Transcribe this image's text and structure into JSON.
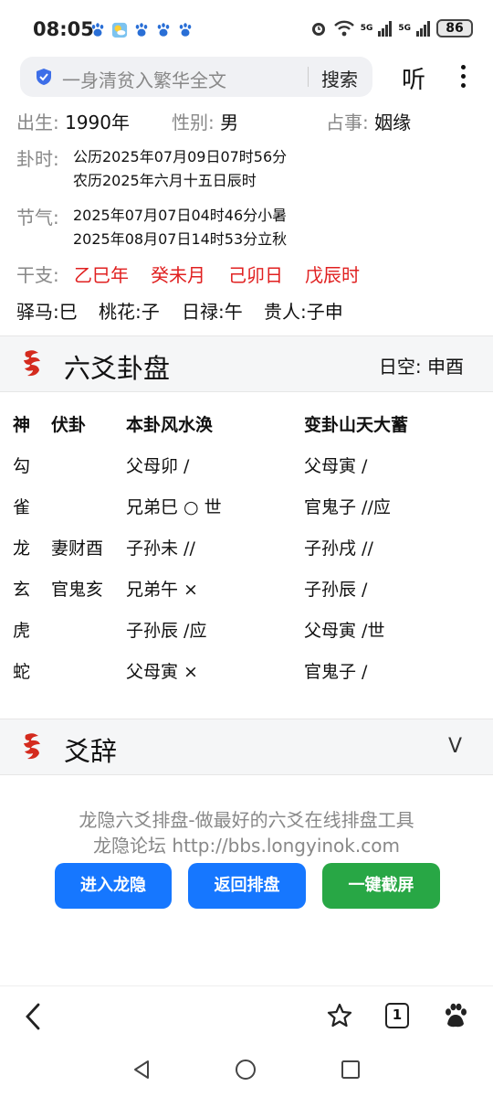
{
  "status_bar": {
    "time": "08:05",
    "battery": "86",
    "net1": "5G",
    "net2": "5G"
  },
  "address_bar": {
    "text": "一身清贫入繁华全文",
    "search_label": "搜索",
    "listen_label": "听"
  },
  "info": {
    "birth_label": "出生:",
    "birth_value": "1990年",
    "gender_label": "性别:",
    "gender_value": "男",
    "matter_label": "占事:",
    "matter_value": "姻缘",
    "time_label": "卦时:",
    "time_line1": "公历2025年07月09日07时56分",
    "time_line2": "农历2025年六月十五日辰时",
    "solar_label": "节气:",
    "solar_line1": "2025年07月07日04时46分小暑",
    "solar_line2": "2025年08月07日14时53分立秋",
    "ganzhi_label": "干支:",
    "ganzhi": [
      "乙巳年",
      "癸未月",
      "己卯日",
      "戊辰时"
    ],
    "extras": [
      "驿马:巳",
      "桃花:子",
      "日禄:午",
      "贵人:子申"
    ]
  },
  "section_gua": {
    "title": "六爻卦盘",
    "kong_label": "日空:",
    "kong_value": "申酉"
  },
  "gua_table": {
    "headers": [
      "神",
      "伏卦",
      "本卦风水涣",
      "变卦山天大蓄"
    ],
    "rows": [
      [
        "勾",
        "",
        "父母卯 /",
        "父母寅 /"
      ],
      [
        "雀",
        "",
        "兄弟巳 ○ 世",
        "官鬼子 //应"
      ],
      [
        "龙",
        "妻财酉",
        "子孙未 //",
        "子孙戌 //"
      ],
      [
        "玄",
        "官鬼亥",
        "兄弟午 ×",
        "子孙辰 /"
      ],
      [
        "虎",
        "",
        "子孙辰 /应",
        "父母寅 /世"
      ],
      [
        "蛇",
        "",
        "父母寅 ×",
        "官鬼子 /"
      ]
    ]
  },
  "section_yaoci": {
    "title": "爻辞",
    "chevron": "V"
  },
  "footer": {
    "line1": "龙隐六爻排盘-做最好的六爻在线排盘工具",
    "line2": "龙隐论坛 http://bbs.longyinok.com",
    "buttons": [
      "进入龙隐",
      "返回排盘",
      "一键截屏"
    ],
    "colors": {
      "blue": "#1677ff",
      "green": "#28a745"
    }
  },
  "bottom_nav": {
    "tabs_count": "1"
  }
}
